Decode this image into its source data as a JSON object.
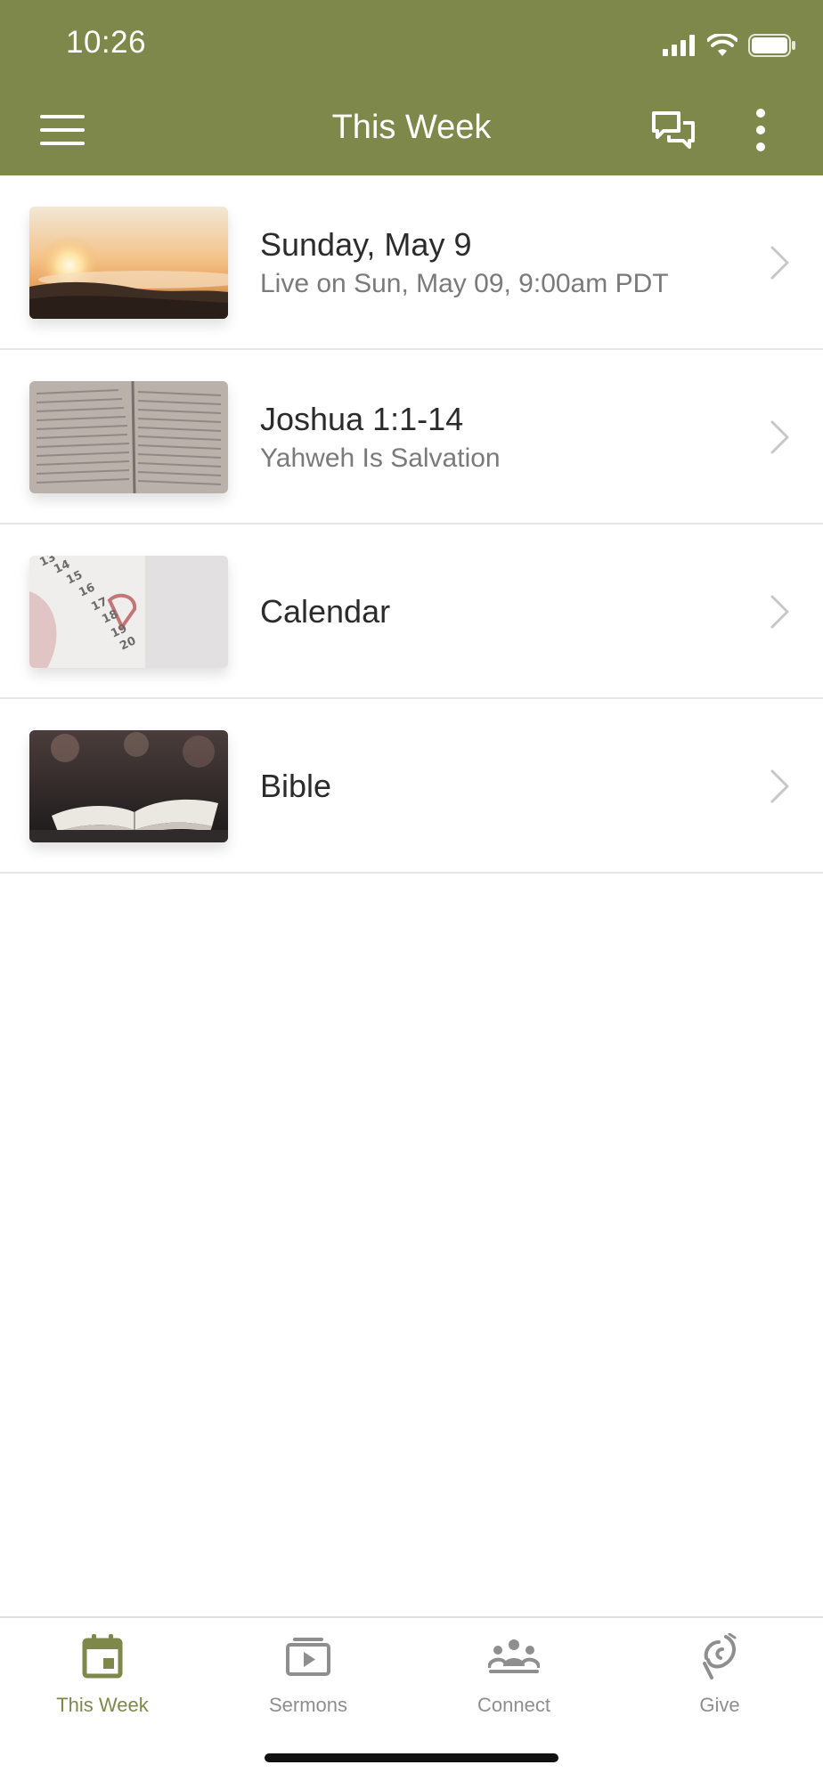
{
  "status_bar": {
    "time": "10:26"
  },
  "header": {
    "title": "This Week"
  },
  "colors": {
    "header_bg": "#7f884b",
    "active_tab": "#7f884b"
  },
  "list": [
    {
      "title": "Sunday, May 9",
      "subtitle": "Live on Sun, May 09, 9:00am PDT",
      "image": "sunrise-mountains"
    },
    {
      "title": "Joshua 1:1-14",
      "subtitle": "Yahweh Is Salvation",
      "image": "bible-page"
    },
    {
      "title": "Calendar",
      "subtitle": "",
      "image": "calendar-pages"
    },
    {
      "title": "Bible",
      "subtitle": "",
      "image": "open-book"
    }
  ],
  "tabs": [
    {
      "label": "This Week",
      "icon": "calendar-icon",
      "active": true
    },
    {
      "label": "Sermons",
      "icon": "play-stack-icon",
      "active": false
    },
    {
      "label": "Connect",
      "icon": "people-icon",
      "active": false
    },
    {
      "label": "Give",
      "icon": "give-icon",
      "active": false
    }
  ]
}
